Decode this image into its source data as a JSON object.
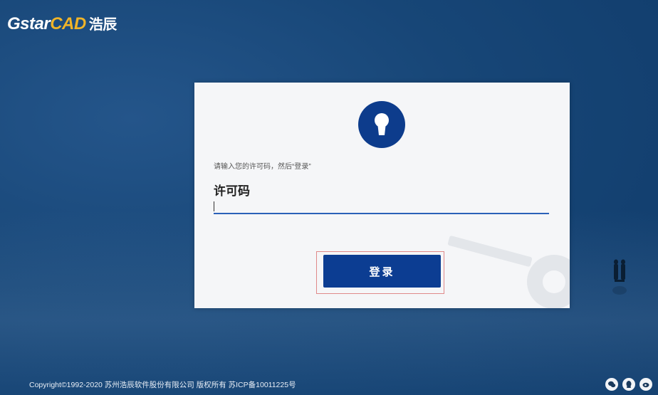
{
  "brand": {
    "name_gstar": "Gstar",
    "name_cad": "CAD",
    "name_zh": "浩辰",
    "accent_color": "#f0b428"
  },
  "dialog": {
    "icon": "lock-icon",
    "hint": "请输入您的许可码，然后“登录”",
    "field_label": "许可码",
    "license_value": "",
    "login_label": "登录",
    "button_color": "#0c3d92"
  },
  "footer": {
    "copyright": "Copyright©1992-2020 苏州浩辰软件股份有限公司 版权所有 苏ICP备10011225号",
    "social_icons": [
      "wechat-icon",
      "qq-icon",
      "weibo-icon"
    ]
  }
}
